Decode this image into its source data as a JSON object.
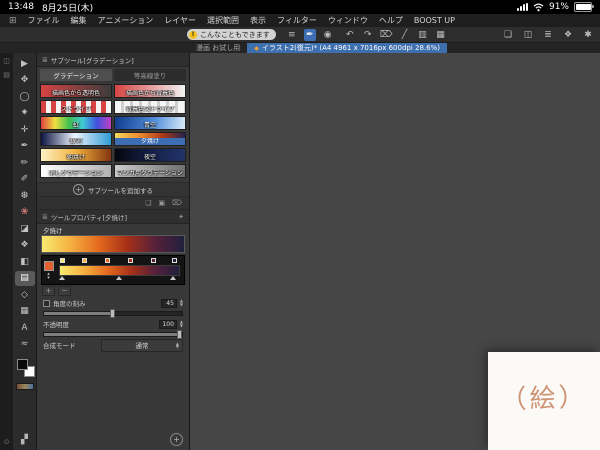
{
  "status_bar": {
    "time": "13:48",
    "date": "8月25日(木)",
    "battery_percent": "91%"
  },
  "menu_bar": {
    "items": [
      "ファイル",
      "編集",
      "アニメーション",
      "レイヤー",
      "選択範囲",
      "表示",
      "フィルター",
      "ウィンドウ",
      "ヘルプ",
      "BOOST UP"
    ]
  },
  "command_bar": {
    "tip_badge": "!",
    "tip_label": "こんなこともできます",
    "left_icons": [
      {
        "name": "palette-menu-icon",
        "glyph": "≡"
      },
      {
        "name": "pen-tool-icon",
        "glyph": "✒"
      },
      {
        "name": "brush-size-icon",
        "glyph": "◉"
      }
    ],
    "mid_icons": [
      {
        "name": "undo-icon",
        "glyph": "↶"
      },
      {
        "name": "redo-icon",
        "glyph": "↷"
      },
      {
        "name": "delete-icon",
        "glyph": "⌦"
      },
      {
        "name": "snap-ruler-icon",
        "glyph": "╱"
      },
      {
        "name": "snap-special-ruler-icon",
        "glyph": "▥"
      },
      {
        "name": "snap-grid-icon",
        "glyph": "▦"
      }
    ],
    "right_icons": [
      {
        "name": "material-palette-icon",
        "glyph": "❑"
      },
      {
        "name": "workspace-icon",
        "glyph": "◫"
      },
      {
        "name": "layer-palette-icon",
        "glyph": "≣"
      },
      {
        "name": "color-palette-icon",
        "glyph": "❖"
      },
      {
        "name": "settings-icon",
        "glyph": "✱"
      }
    ]
  },
  "tab_bar": {
    "inactive_tab": "漫画 お試し用",
    "active_marker": "◆",
    "active_tab": "イラスト2(復元)* (A4 4961 x 7016px 600dpi 28.6%)"
  },
  "toolbox": {
    "tools": [
      {
        "name": "operation",
        "glyph": "▶"
      },
      {
        "name": "move",
        "glyph": "✥"
      },
      {
        "name": "selection",
        "glyph": "◯"
      },
      {
        "name": "auto-select",
        "glyph": "✷"
      },
      {
        "name": "eyedropper",
        "glyph": "✛"
      },
      {
        "name": "pen",
        "glyph": "✒"
      },
      {
        "name": "pencil",
        "glyph": "✏"
      },
      {
        "name": "brush",
        "glyph": "✐"
      },
      {
        "name": "airbrush",
        "glyph": "❆"
      },
      {
        "name": "decoration",
        "glyph": "❀"
      },
      {
        "name": "eraser",
        "glyph": "◪"
      },
      {
        "name": "blend",
        "glyph": "❖"
      },
      {
        "name": "fill",
        "glyph": "◧"
      },
      {
        "name": "gradient",
        "glyph": "▤"
      },
      {
        "name": "figure",
        "glyph": "◇"
      },
      {
        "name": "frame",
        "glyph": "▦"
      },
      {
        "name": "text",
        "glyph": "A"
      },
      {
        "name": "line-correction",
        "glyph": "≈"
      }
    ],
    "pattern_tool_glyph": "▞"
  },
  "edge_strip": {
    "icons": [
      {
        "name": "collapse-palette-icon",
        "glyph": "◫"
      },
      {
        "name": "quick-access-icon",
        "glyph": "▤"
      },
      {
        "name": "edge-bottom-icon",
        "glyph": "⊙"
      }
    ]
  },
  "subtool_panel": {
    "title": "サブツール[グラデーション]",
    "header_icon": "≣",
    "tab_gradient": "グラデーション",
    "tab_contour": "等高線塗り",
    "items": [
      {
        "label": "描画色から透明色",
        "style": "background:linear-gradient(90deg,#d74343,#3c3c3c)"
      },
      {
        "label": "描画色から背景色",
        "style": "background:linear-gradient(90deg,#d74343,#f2f2f2)"
      },
      {
        "label": "ストライプ",
        "style": "background:repeating-linear-gradient(90deg,#d74343 0 5px,#f5f5f5 5px 10px)"
      },
      {
        "label": "背景色ストライプ",
        "style": "background:repeating-linear-gradient(90deg,#f5f5f5 0 6px,#cfcfcf 6px 9px)"
      },
      {
        "label": "虹",
        "style": "background:linear-gradient(90deg,#e04040,#eee040,#40c050,#40c8d8,#4050e0,#c040c0)"
      },
      {
        "label": "青空",
        "style": "background:linear-gradient(100deg,#123c8e,#4f8cd8 55%,#dcecfa)"
      },
      {
        "label": "銀河",
        "style": "background:linear-gradient(90deg,#0c1442,#eef4ff 48%,#2f9ad4)"
      },
      {
        "label": "夕焼け",
        "style": "background:linear-gradient(90deg,#f6d85c,#ee8f30,#b23a18,#262350)"
      },
      {
        "label": "朝焼け",
        "style": "background:linear-gradient(90deg,#fdf2c4,#f2b03c,#83350f)"
      },
      {
        "label": "夜空",
        "style": "background:linear-gradient(90deg,#05070e,#141f46,#22346a)"
      },
      {
        "label": "消しグラデーション",
        "style": "background:linear-gradient(90deg,#ffffff,#b2b2b2)"
      },
      {
        "label": "マンガ用グラデーション",
        "style": "background:linear-gradient(90deg,#cccccc,#707070)"
      }
    ],
    "add_plus": "＋",
    "add_label": "サブツールを追加する",
    "panel_icons": [
      {
        "name": "export-subtool-icon",
        "glyph": "❏"
      },
      {
        "name": "folder-icon",
        "glyph": "▣"
      },
      {
        "name": "trash-icon",
        "glyph": "⌦"
      }
    ]
  },
  "tool_property": {
    "title": "ツールプロパティ[夕焼け]",
    "wrench_icon": "✦",
    "tool_name": "夕焼け",
    "preview_style": "background:linear-gradient(90deg,#f8ea70,#f5b040,#e4691e,#a63018,#55203a,#20203c)",
    "nodes": [
      {
        "style": "left:1%;background:#f8ea70"
      },
      {
        "style": "left:19%;background:#f5b040"
      },
      {
        "style": "left:38%;background:#e4691e"
      },
      {
        "style": "left:57%;background:#a63018"
      },
      {
        "style": "left:76%;background:#55203a"
      },
      {
        "style": "left:93%;background:#20203c"
      }
    ],
    "add_node": "＋",
    "remove_node": "－",
    "angle_label": "角度の刻み",
    "angle_value": "45",
    "opacity_label": "不透明度",
    "opacity_value": "100",
    "blend_label": "合成モード",
    "blend_value": "通常",
    "panel_add": "+"
  },
  "canvas": {
    "drawing_text": "（絵）",
    "ink_style": "color:#cd9374"
  }
}
